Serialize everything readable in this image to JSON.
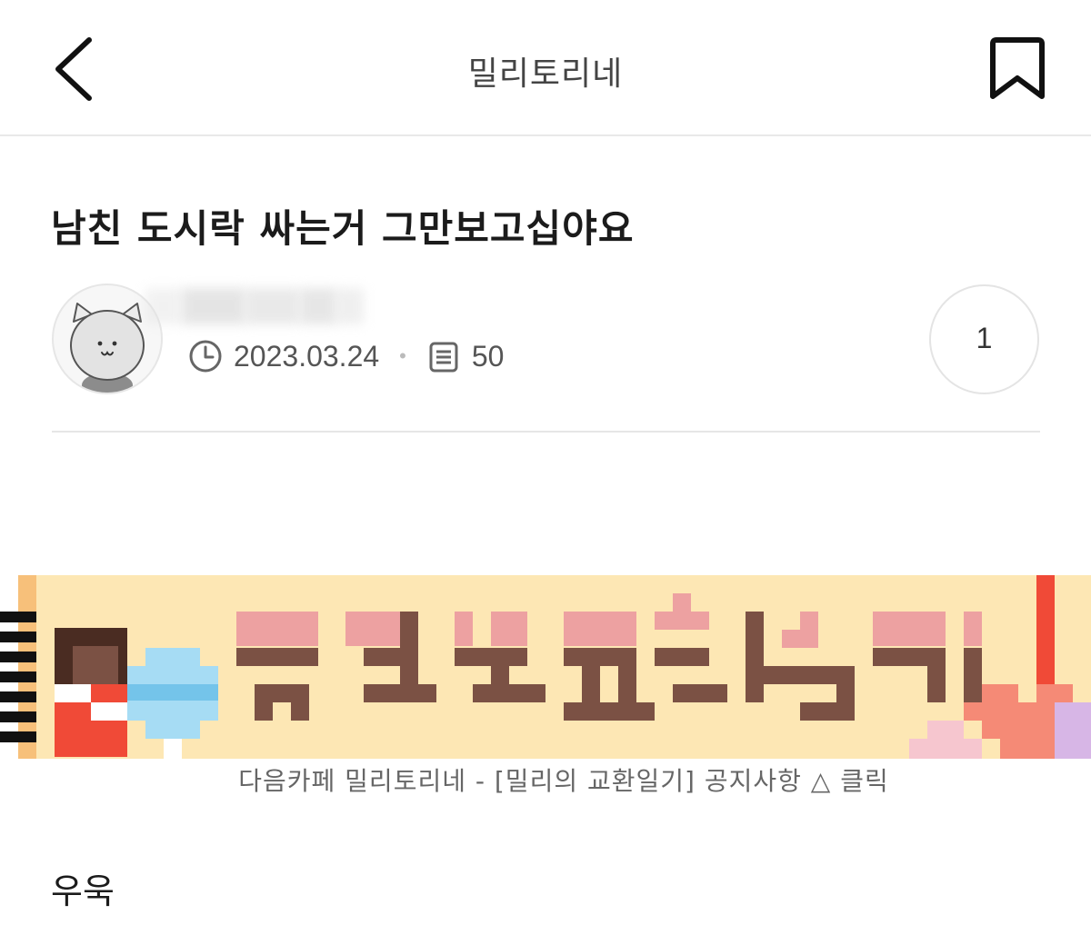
{
  "header": {
    "title": "밀리토리네",
    "back_icon": "chevron-left-icon",
    "bookmark_icon": "bookmark-icon"
  },
  "post": {
    "title": "남친 도시락 싸는거 그만보고십야요",
    "date": "2023.03.24",
    "views": "50",
    "comment_count": "1",
    "avatar_icon": "cat-avatar",
    "body": "우욱"
  },
  "banner": {
    "title_art": "밀리의교환일기!",
    "caption": "다음카페 밀리토리네 - [밀리의 교환일기] 공지사항 △ 클릭"
  },
  "colors": {
    "banner_bg": "#fde7b4",
    "pixel_pink": "#eda1a1",
    "pixel_brown": "#7b5144",
    "accent_red": "#f04a37"
  }
}
